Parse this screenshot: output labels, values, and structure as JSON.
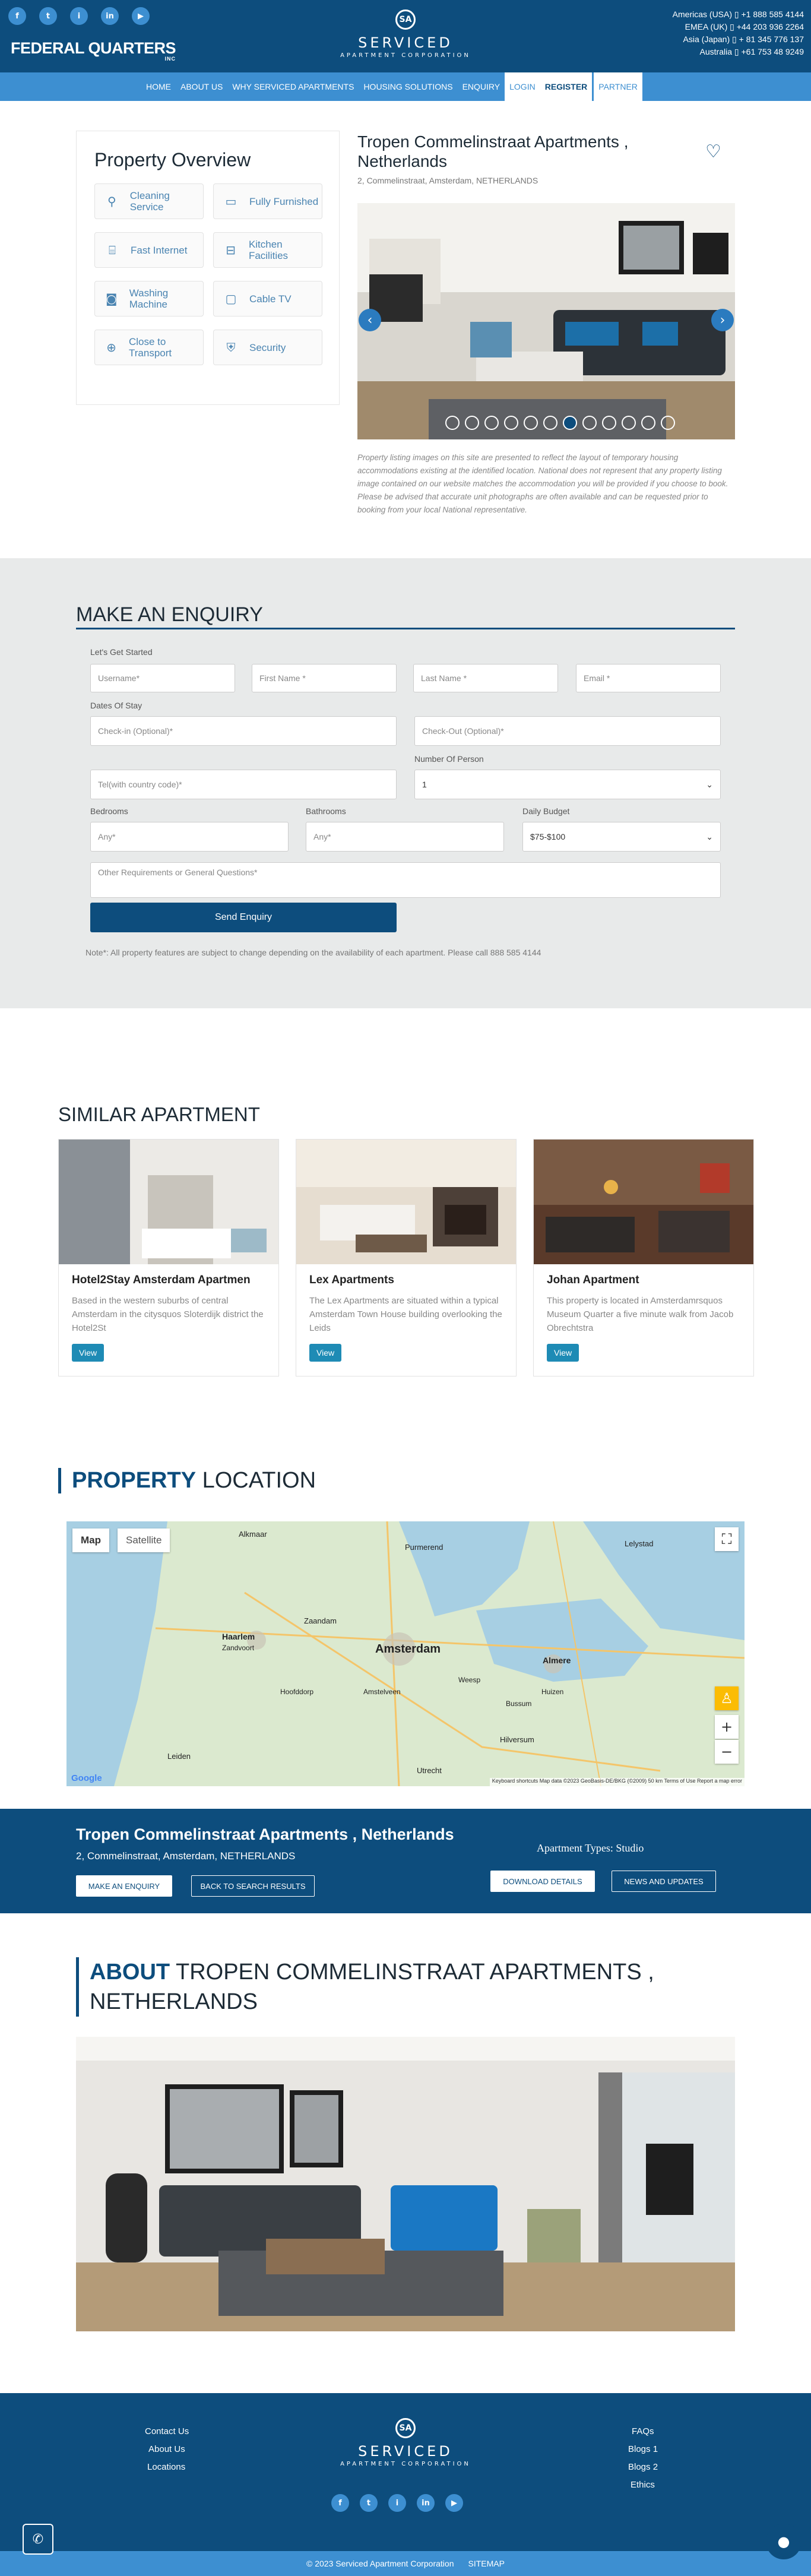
{
  "social": {
    "facebook": "f",
    "twitter": "t",
    "instagram": "i",
    "linkedin": "in",
    "youtube": "▶"
  },
  "header": {
    "fq_main": "FEDERAL QUARTERS",
    "fq_sub": "INC",
    "brand_title": "SERVICED",
    "brand_sub": "APARTMENT CORPORATION",
    "phones": [
      "Americas (USA) ▯ +1 888 585 4144",
      "EMEA (UK) ▯ +44 203 936 2264",
      "Asia (Japan) ▯ + 81 345 776 137",
      "Australia ▯ +61 753 48 9249"
    ]
  },
  "nav": {
    "items": [
      "HOME",
      "ABOUT US",
      "WHY SERVICED APARTMENTS",
      "HOUSING SOLUTIONS",
      "ENQUIRY"
    ],
    "login": "LOGIN",
    "register": "REGISTER",
    "partner": "PARTNER"
  },
  "overview": {
    "title": "Property Overview",
    "features": [
      {
        "label": "Cleaning Service",
        "icon": "cleaning-icon"
      },
      {
        "label": "Fully Furnished",
        "icon": "sofa-icon"
      },
      {
        "label": "Fast Internet",
        "icon": "router-icon"
      },
      {
        "label": "Kitchen Facilities",
        "icon": "kitchen-icon"
      },
      {
        "label": "Washing Machine",
        "icon": "washing-machine-icon"
      },
      {
        "label": "Cable TV",
        "icon": "tv-icon"
      },
      {
        "label": "Close to Transport",
        "icon": "transport-icon"
      },
      {
        "label": "Security",
        "icon": "shield-icon"
      }
    ]
  },
  "property": {
    "title": "Tropen Commelinstraat Apartments , Netherlands",
    "address": "2, Commelinstraat, Amsterdam, NETHERLANDS",
    "disclaimer": "Property listing images on this site are presented to reflect the layout of temporary housing accommodations existing at the identified location. National does not represent that any property listing image contained on our website matches the accommodation you will be provided if you choose to book. Please be advised that accurate unit photographs are often available and can be requested prior to booking from your local National representative."
  },
  "enquiry": {
    "title": "MAKE AN ENQUIRY",
    "lets": "Let's Get Started",
    "username": "Username*",
    "firstname": "First Name *",
    "lastname": "Last Name *",
    "email": "Email *",
    "dates_label": "Dates Of Stay",
    "checkin": "Check-in (Optional)*",
    "checkout": "Check-Out (Optional)*",
    "persons_label": "Number Of Person",
    "tel": "Tel(with country code)*",
    "persons": "1",
    "bedrooms_label": "Bedrooms",
    "bathrooms_label": "Bathrooms",
    "budget_label": "Daily Budget",
    "bedrooms": "Any*",
    "bathrooms": "Any*",
    "budget": "$75-$100",
    "other": "Other Requirements or General Questions*",
    "send": "Send Enquiry",
    "note": "Note*: All property features are subject to change depending on the availability of each apartment. Please call 888 585 4144"
  },
  "similar": {
    "title": "SIMILAR APARTMENT",
    "view": "View",
    "cards": [
      {
        "title": "Hotel2Stay Amsterdam Apartmen",
        "text": "Based in the western suburbs of central Amsterdam in the citysquos Sloterdijk district the Hotel2St"
      },
      {
        "title": "Lex Apartments",
        "text": "The Lex Apartments are situated within a typical Amsterdam Town House building overlooking the Leids"
      },
      {
        "title": "Johan Apartment",
        "text": "This property is located in Amsterdamrsquos Museum Quarter a five minute walk from Jacob Obrechtstra"
      }
    ]
  },
  "location": {
    "title_a": "PROPERTY",
    "title_b": " LOCATION",
    "map_tab": "Map",
    "sat_tab": "Satellite",
    "city": "Amsterdam",
    "places": [
      "Haarlem",
      "Zandvoort",
      "Almere",
      "Lelystad",
      "Purmerend",
      "Zaandam",
      "Hilversum",
      "Utrecht",
      "Leiden",
      "Alkmaar",
      "Weesp",
      "Bussum",
      "Huizen",
      "Amstelveen",
      "Hoofddorp"
    ],
    "attribution": "Keyboard shortcuts  Map data ©2023 GeoBasis-DE/BKG (©2009)  50 km  Terms of Use  Report a map error",
    "google": "Google"
  },
  "bar": {
    "title": "Tropen Commelinstraat Apartments , Netherlands",
    "address": "2, Commelinstraat, Amsterdam, NETHERLANDS",
    "apt_type": "Apartment Types: Studio",
    "make": "MAKE AN ENQUIRY",
    "back": "BACK TO SEARCH RESULTS",
    "download": "DOWNLOAD DETAILS",
    "news": "NEWS AND UPDATES"
  },
  "about": {
    "title_a": "ABOUT",
    "title_b": " TROPEN COMMELINSTRAAT APARTMENTS , NETHERLANDS"
  },
  "footer": {
    "left": [
      "Contact Us",
      "About Us",
      "Locations"
    ],
    "right": [
      "FAQs",
      "Blogs 1",
      "Blogs 2",
      "Ethics"
    ],
    "copyright": "© 2023 Serviced Apartment Corporation",
    "sitemap": "SITEMAP"
  },
  "colors": {
    "primary": "#0d4d7d",
    "accent": "#3d8fd1",
    "view": "#1e8bb5"
  }
}
